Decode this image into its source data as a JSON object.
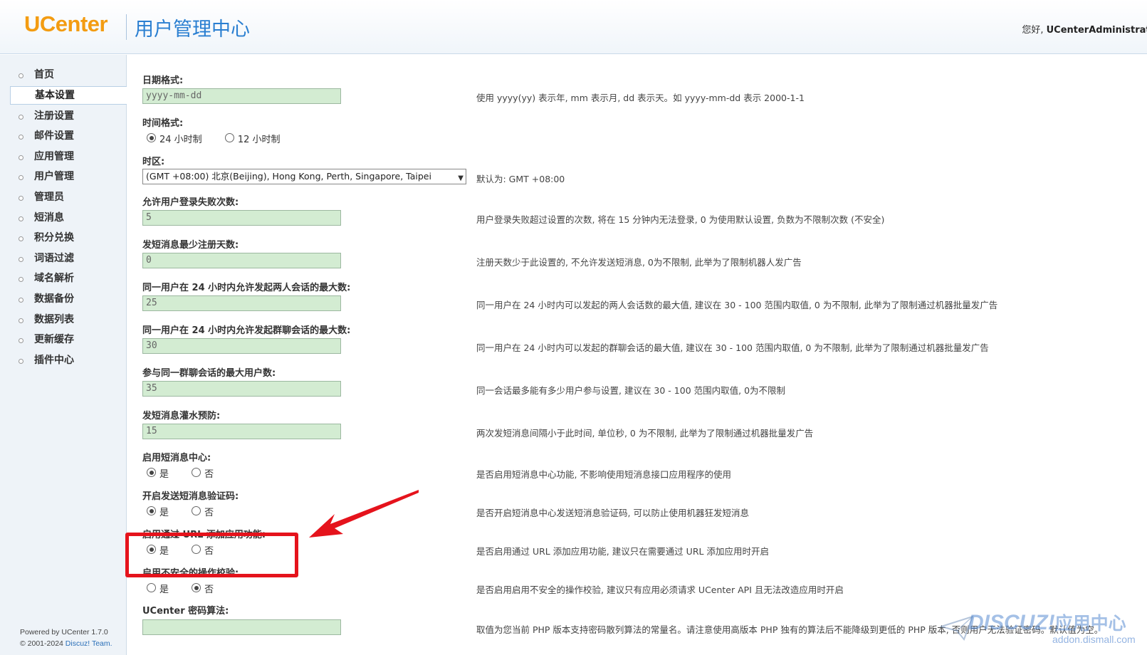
{
  "header": {
    "logo": "UCenter",
    "title": "用户管理中心",
    "greeting_prefix": "您好,",
    "username": "UCenterAdministrator"
  },
  "sidebar": {
    "items": [
      {
        "label": "首页",
        "active": false
      },
      {
        "label": "基本设置",
        "active": true
      },
      {
        "label": "注册设置",
        "active": false
      },
      {
        "label": "邮件设置",
        "active": false
      },
      {
        "label": "应用管理",
        "active": false
      },
      {
        "label": "用户管理",
        "active": false
      },
      {
        "label": "管理员",
        "active": false
      },
      {
        "label": "短消息",
        "active": false
      },
      {
        "label": "积分兑换",
        "active": false
      },
      {
        "label": "词语过滤",
        "active": false
      },
      {
        "label": "域名解析",
        "active": false
      },
      {
        "label": "数据备份",
        "active": false
      },
      {
        "label": "数据列表",
        "active": false
      },
      {
        "label": "更新缓存",
        "active": false
      },
      {
        "label": "插件中心",
        "active": false
      }
    ],
    "footer": {
      "powered": "Powered by UCenter 1.7.0",
      "copyright_prefix": "© 2001-2024",
      "copyright_link": "Discuz! Team."
    }
  },
  "form": {
    "date_format": {
      "label": "日期格式:",
      "value": "yyyy-mm-dd",
      "desc": "使用 yyyy(yy) 表示年, mm 表示月, dd 表示天。如 yyyy-mm-dd 表示 2000-1-1"
    },
    "time_format": {
      "label": "时间格式:",
      "options": [
        "24 小时制",
        "12 小时制"
      ],
      "selected": 0
    },
    "timezone": {
      "label": "时区:",
      "value": "(GMT +08:00) 北京(Beijing), Hong Kong, Perth, Singapore, Taipei",
      "desc": "默认为: GMT +08:00"
    },
    "login_fail": {
      "label": "允许用户登录失败次数:",
      "value": "5",
      "desc": "用户登录失败超过设置的次数, 将在 15 分钟内无法登录, 0 为使用默认设置, 负数为不限制次数 (不安全)"
    },
    "pm_min_days": {
      "label": "发短消息最少注册天数:",
      "value": "0",
      "desc": "注册天数少于此设置的, 不允许发送短消息, 0为不限制, 此举为了限制机器人发广告"
    },
    "pm_max_private": {
      "label": "同一用户在 24 小时内允许发起两人会话的最大数:",
      "value": "25",
      "desc": "同一用户在 24 小时内可以发起的两人会话数的最大值, 建议在 30 - 100 范围内取值, 0 为不限制, 此举为了限制通过机器批量发广告"
    },
    "pm_max_group": {
      "label": "同一用户在 24 小时内允许发起群聊会话的最大数:",
      "value": "30",
      "desc": "同一用户在 24 小时内可以发起的群聊会话的最大值, 建议在 30 - 100 范围内取值, 0 为不限制, 此举为了限制通过机器批量发广告"
    },
    "pm_group_members": {
      "label": "参与同一群聊会话的最大用户数:",
      "value": "35",
      "desc": "同一会话最多能有多少用户参与设置, 建议在 30 - 100 范围内取值, 0为不限制"
    },
    "pm_flood": {
      "label": "发短消息灌水预防:",
      "value": "15",
      "desc": "两次发短消息间隔小于此时间, 单位秒, 0 为不限制, 此举为了限制通过机器批量发广告"
    },
    "pm_center": {
      "label": "启用短消息中心:",
      "options": [
        "是",
        "否"
      ],
      "selected": 0,
      "desc": "是否启用短消息中心功能, 不影响使用短消息接口应用程序的使用"
    },
    "pm_seccode": {
      "label": "开启发送短消息验证码:",
      "options": [
        "是",
        "否"
      ],
      "selected": 0,
      "desc": "是否开启短消息中心发送短消息验证码, 可以防止使用机器狂发短消息"
    },
    "add_app_url": {
      "label": "启用通过 URL 添加应用功能:",
      "options": [
        "是",
        "否"
      ],
      "selected": 0,
      "desc": "是否启用通过 URL 添加应用功能, 建议只在需要通过 URL 添加应用时开启"
    },
    "insecure_check": {
      "label": "启用不安全的操作校验:",
      "options": [
        "是",
        "否"
      ],
      "selected": 1,
      "desc": "是否启用启用不安全的操作校验, 建议只有应用必须请求 UCenter API 且无法改造应用时开启"
    },
    "password_algo": {
      "label": "UCenter 密码算法:",
      "value": "",
      "desc": "取值为您当前 PHP 版本支持密码散列算法的常量名。请注意使用高版本 PHP 独有的算法后不能降级到更低的 PHP 版本, 否则用户无法验证密码。默认值为空。"
    }
  },
  "colors": {
    "accent_red": "#e5131c",
    "input_bg": "#d3ecd2",
    "brand_blue": "#2a7fd1",
    "brand_orange": "#f39c12"
  },
  "watermark": {
    "brand": "DISCUZ!",
    "zh": "应用中心",
    "domain": "addon.dismall.com"
  }
}
